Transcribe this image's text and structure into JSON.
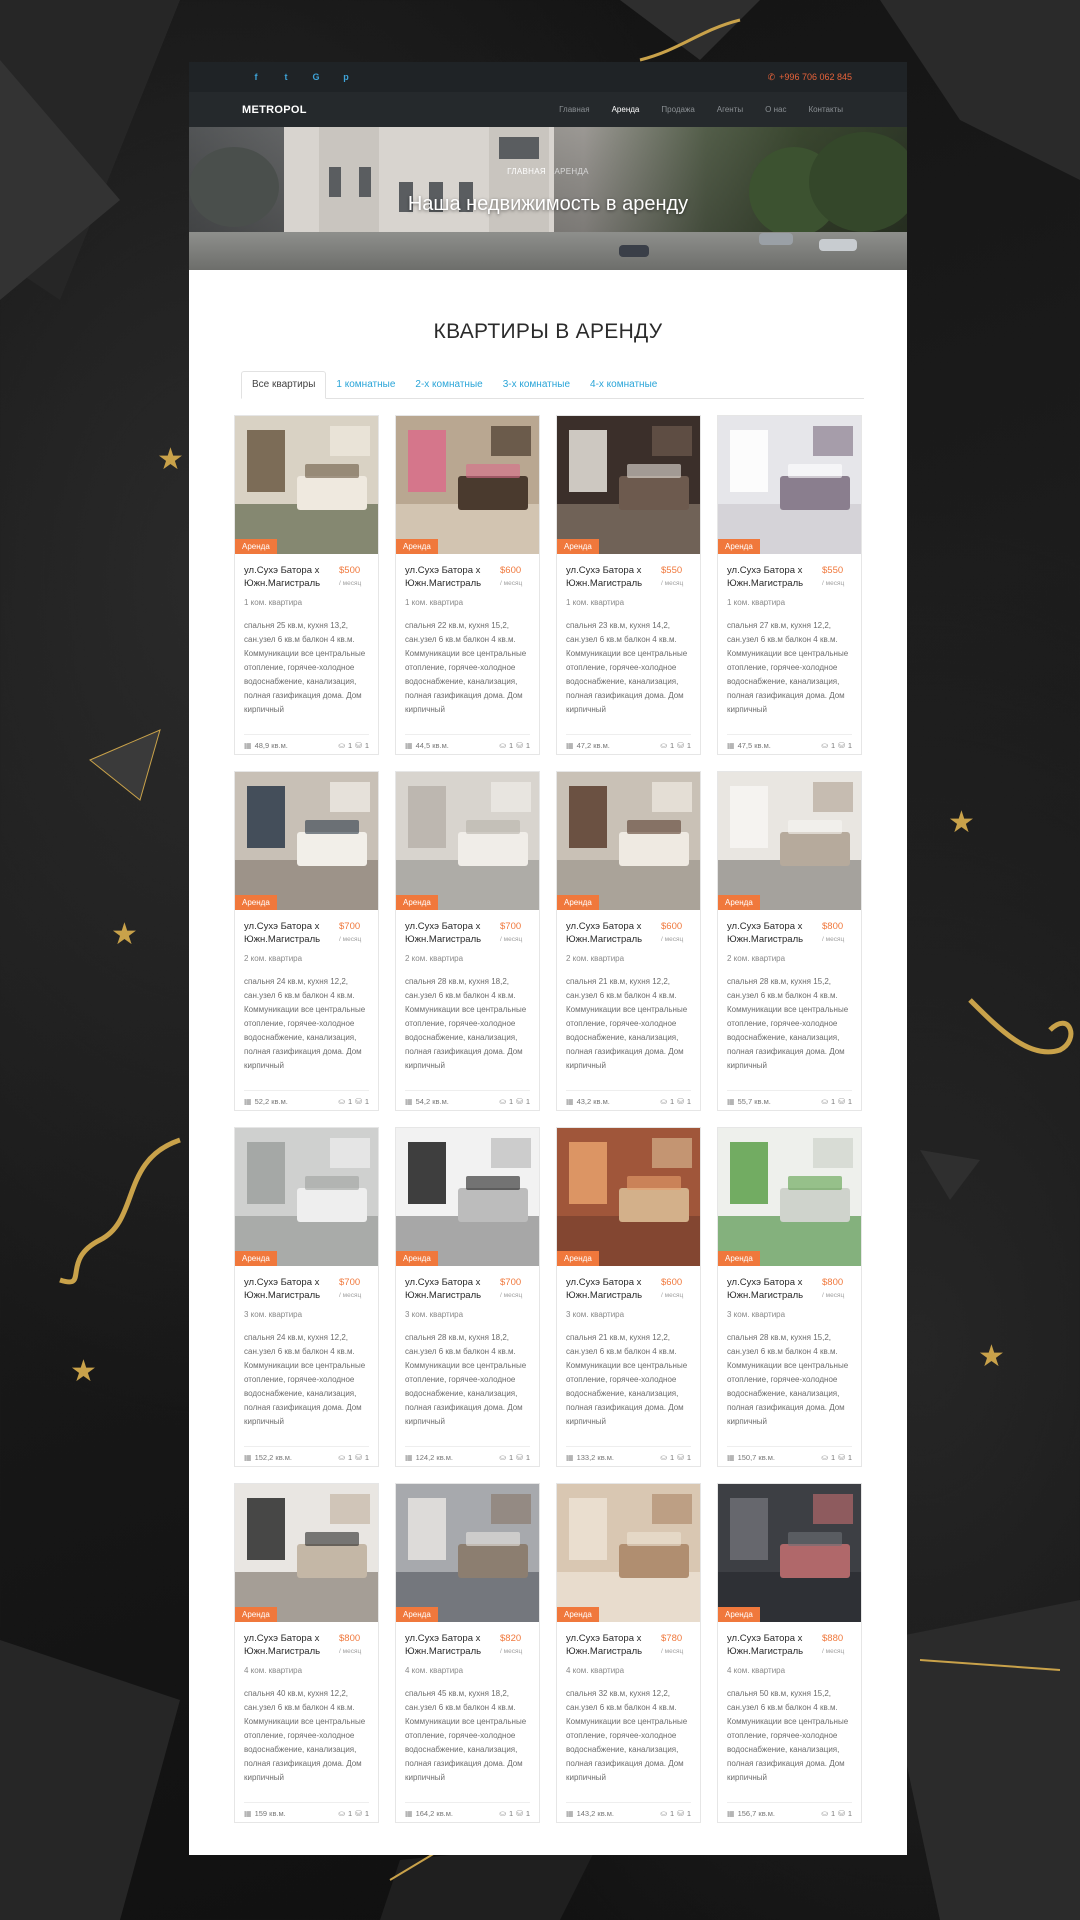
{
  "topbar": {
    "socials": [
      "f",
      "t",
      "G",
      "p"
    ],
    "phone": "+996 706 062 845"
  },
  "navbar": {
    "logo": "METROPOL",
    "menu": [
      "Главная",
      "Аренда",
      "Продажа",
      "Агенты",
      "О нас",
      "Контакты"
    ]
  },
  "hero": {
    "breadcrumb_home": "ГЛАВНАЯ",
    "breadcrumb_current": "АРЕНДА",
    "title": "Наша недвижимость в аренду"
  },
  "section": {
    "title": "КВАРТИРЫ В АРЕНДУ"
  },
  "tabs": [
    "Все квартиры",
    "1 комнатные",
    "2-х комнатные",
    "3-х комнатные",
    "4-х комнатные"
  ],
  "badge": "Аренда",
  "per_month": "/ месяц",
  "listings": [
    {
      "address": "ул.Сухэ Батора х Южн.Магистраль",
      "price": "$500",
      "type": "1 ком. квартира",
      "description": "спальня 25 кв.м, кухня 13,2, сан.узел 6 кв.м балкон 4 кв.м. Коммуникации все центральные отопление, горячее-холодное водоснабжение, канализация, полная газификация дома. Дом кирпичный",
      "area": "48,9 кв.м.",
      "baths": "1",
      "beds": "1"
    },
    {
      "address": "ул.Сухэ Батора х Южн.Магистраль",
      "price": "$600",
      "type": "1 ком. квартира",
      "description": "спальня 22 кв.м, кухня 15,2, сан.узел 6 кв.м балкон 4 кв.м. Коммуникации все центральные отопление, горячее-холодное водоснабжение, канализация, полная газификация дома. Дом кирпичный",
      "area": "44,5 кв.м.",
      "baths": "1",
      "beds": "1"
    },
    {
      "address": "ул.Сухэ Батора х Южн.Магистраль",
      "price": "$550",
      "type": "1 ком. квартира",
      "description": "спальня 23 кв.м, кухня 14,2, сан.узел 6 кв.м балкон 4 кв.м. Коммуникации все центральные отопление, горячее-холодное водоснабжение, канализация, полная газификация дома. Дом кирпичный",
      "area": "47,2 кв.м.",
      "baths": "1",
      "beds": "1"
    },
    {
      "address": "ул.Сухэ Батора х Южн.Магистраль",
      "price": "$550",
      "type": "1 ком. квартира",
      "description": "спальня 27 кв.м, кухня 12,2, сан.узел 6 кв.м балкон 4 кв.м. Коммуникации все центральные отопление, горячее-холодное водоснабжение, канализация, полная газификация дома. Дом кирпичный",
      "area": "47,5 кв.м.",
      "baths": "1",
      "beds": "1"
    },
    {
      "address": "ул.Сухэ Батора х Южн.Магистраль",
      "price": "$700",
      "type": "2 ком. квартира",
      "description": "спальня 24 кв.м, кухня 12,2, сан.узел 6 кв.м балкон 4 кв.м. Коммуникации все центральные отопление, горячее-холодное водоснабжение, канализация, полная газификация дома. Дом кирпичный",
      "area": "52,2 кв.м.",
      "baths": "1",
      "beds": "1"
    },
    {
      "address": "ул.Сухэ Батора х Южн.Магистраль",
      "price": "$700",
      "type": "2 ком. квартира",
      "description": "спальня 28 кв.м, кухня 18,2, сан.узел 6 кв.м балкон 4 кв.м. Коммуникации все центральные отопление, горячее-холодное водоснабжение, канализация, полная газификация дома. Дом кирпичный",
      "area": "54,2 кв.м.",
      "baths": "1",
      "beds": "1"
    },
    {
      "address": "ул.Сухэ Батора х Южн.Магистраль",
      "price": "$600",
      "type": "2 ком. квартира",
      "description": "спальня 21 кв.м, кухня 12,2, сан.узел 6 кв.м балкон 4 кв.м. Коммуникации все центральные отопление, горячее-холодное водоснабжение, канализация, полная газификация дома. Дом кирпичный",
      "area": "43,2 кв.м.",
      "baths": "1",
      "beds": "1"
    },
    {
      "address": "ул.Сухэ Батора х Южн.Магистраль",
      "price": "$800",
      "type": "2 ком. квартира",
      "description": "спальня 28 кв.м, кухня 15,2, сан.узел 6 кв.м балкон 4 кв.м. Коммуникации все центральные отопление, горячее-холодное водоснабжение, канализация, полная газификация дома. Дом кирпичный",
      "area": "55,7 кв.м.",
      "baths": "1",
      "beds": "1"
    },
    {
      "address": "ул.Сухэ Батора х Южн.Магистраль",
      "price": "$700",
      "type": "3 ком. квартира",
      "description": "спальня 24 кв.м, кухня 12,2, сан.узел 6 кв.м балкон 4 кв.м. Коммуникации все центральные отопление, горячее-холодное водоснабжение, канализация, полная газификация дома. Дом кирпичный",
      "area": "152,2 кв.м.",
      "baths": "1",
      "beds": "1"
    },
    {
      "address": "ул.Сухэ Батора х Южн.Магистраль",
      "price": "$700",
      "type": "3 ком. квартира",
      "description": "спальня 28 кв.м, кухня 18,2, сан.узел 6 кв.м балкон 4 кв.м. Коммуникации все центральные отопление, горячее-холодное водоснабжение, канализация, полная газификация дома. Дом кирпичный",
      "area": "124,2 кв.м.",
      "baths": "1",
      "beds": "1"
    },
    {
      "address": "ул.Сухэ Батора х Южн.Магистраль",
      "price": "$600",
      "type": "3 ком. квартира",
      "description": "спальня 21 кв.м, кухня 12,2, сан.узел 6 кв.м балкон 4 кв.м. Коммуникации все центральные отопление, горячее-холодное водоснабжение, канализация, полная газификация дома. Дом кирпичный",
      "area": "133,2 кв.м.",
      "baths": "1",
      "beds": "1"
    },
    {
      "address": "ул.Сухэ Батора х Южн.Магистраль",
      "price": "$800",
      "type": "3 ком. квартира",
      "description": "спальня 28 кв.м, кухня 15,2, сан.узел 6 кв.м балкон 4 кв.м. Коммуникации все центральные отопление, горячее-холодное водоснабжение, канализация, полная газификация дома. Дом кирпичный",
      "area": "150,7 кв.м.",
      "baths": "1",
      "beds": "1"
    },
    {
      "address": "ул.Сухэ Батора х Южн.Магистраль",
      "price": "$800",
      "type": "4 ком. квартира",
      "description": "спальня 40 кв.м, кухня 12,2, сан.узел 6 кв.м балкон 4 кв.м. Коммуникации все центральные отопление, горячее-холодное водоснабжение, канализация, полная газификация дома. Дом кирпичный",
      "area": "159 кв.м.",
      "baths": "1",
      "beds": "1"
    },
    {
      "address": "ул.Сухэ Батора х Южн.Магистраль",
      "price": "$820",
      "type": "4 ком. квартира",
      "description": "спальня 45 кв.м, кухня 18,2, сан.узел 6 кв.м балкон 4 кв.м. Коммуникации все центральные отопление, горячее-холодное водоснабжение, канализация, полная газификация дома. Дом кирпичный",
      "area": "164,2 кв.м.",
      "baths": "1",
      "beds": "1"
    },
    {
      "address": "ул.Сухэ Батора х Южн.Магистраль",
      "price": "$780",
      "type": "4 ком. квартира",
      "description": "спальня 32 кв.м, кухня 12,2, сан.узел 6 кв.м балкон 4 кв.м. Коммуникации все центральные отопление, горячее-холодное водоснабжение, канализация, полная газификация дома. Дом кирпичный",
      "area": "143,2 кв.м.",
      "baths": "1",
      "beds": "1"
    },
    {
      "address": "ул.Сухэ Батора х Южн.Магистраль",
      "price": "$880",
      "type": "4 ком. квартира",
      "description": "спальня 50 кв.м, кухня 15,2, сан.узел 6 кв.м балкон 4 кв.м. Коммуникации все центральные отопление, горячее-холодное водоснабжение, канализация, полная газификация дома. Дом кирпичный",
      "area": "156,7 кв.м.",
      "baths": "1",
      "beds": "1"
    }
  ],
  "colors": {
    "accent": "#f0783c",
    "link": "#2aa5d8",
    "dark_header": "#25292c",
    "gold": "#c9a24a"
  }
}
